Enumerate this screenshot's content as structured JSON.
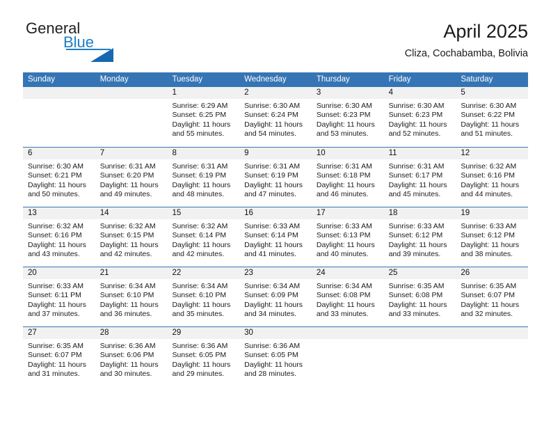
{
  "brand": {
    "word_one": "General",
    "word_two": "Blue",
    "mark": "triangle-logo"
  },
  "header": {
    "title": "April 2025",
    "subtitle": "Cliza, Cochabamba, Bolivia"
  },
  "colors": {
    "header_blue": "#3575b5",
    "brand_blue": "#1b7fc4",
    "brand_mark_blue": "#1669b0",
    "day_number_band": "#f1f1f1",
    "text": "#1a1a1a"
  },
  "weekdays": [
    "Sunday",
    "Monday",
    "Tuesday",
    "Wednesday",
    "Thursday",
    "Friday",
    "Saturday"
  ],
  "weeks": [
    [
      {
        "day": "",
        "empty": true
      },
      {
        "day": "",
        "empty": true
      },
      {
        "day": "1",
        "sunrise": "Sunrise: 6:29 AM",
        "sunset": "Sunset: 6:25 PM",
        "daylight": "Daylight: 11 hours and 55 minutes."
      },
      {
        "day": "2",
        "sunrise": "Sunrise: 6:30 AM",
        "sunset": "Sunset: 6:24 PM",
        "daylight": "Daylight: 11 hours and 54 minutes."
      },
      {
        "day": "3",
        "sunrise": "Sunrise: 6:30 AM",
        "sunset": "Sunset: 6:23 PM",
        "daylight": "Daylight: 11 hours and 53 minutes."
      },
      {
        "day": "4",
        "sunrise": "Sunrise: 6:30 AM",
        "sunset": "Sunset: 6:23 PM",
        "daylight": "Daylight: 11 hours and 52 minutes."
      },
      {
        "day": "5",
        "sunrise": "Sunrise: 6:30 AM",
        "sunset": "Sunset: 6:22 PM",
        "daylight": "Daylight: 11 hours and 51 minutes."
      }
    ],
    [
      {
        "day": "6",
        "sunrise": "Sunrise: 6:30 AM",
        "sunset": "Sunset: 6:21 PM",
        "daylight": "Daylight: 11 hours and 50 minutes."
      },
      {
        "day": "7",
        "sunrise": "Sunrise: 6:31 AM",
        "sunset": "Sunset: 6:20 PM",
        "daylight": "Daylight: 11 hours and 49 minutes."
      },
      {
        "day": "8",
        "sunrise": "Sunrise: 6:31 AM",
        "sunset": "Sunset: 6:19 PM",
        "daylight": "Daylight: 11 hours and 48 minutes."
      },
      {
        "day": "9",
        "sunrise": "Sunrise: 6:31 AM",
        "sunset": "Sunset: 6:19 PM",
        "daylight": "Daylight: 11 hours and 47 minutes."
      },
      {
        "day": "10",
        "sunrise": "Sunrise: 6:31 AM",
        "sunset": "Sunset: 6:18 PM",
        "daylight": "Daylight: 11 hours and 46 minutes."
      },
      {
        "day": "11",
        "sunrise": "Sunrise: 6:31 AM",
        "sunset": "Sunset: 6:17 PM",
        "daylight": "Daylight: 11 hours and 45 minutes."
      },
      {
        "day": "12",
        "sunrise": "Sunrise: 6:32 AM",
        "sunset": "Sunset: 6:16 PM",
        "daylight": "Daylight: 11 hours and 44 minutes."
      }
    ],
    [
      {
        "day": "13",
        "sunrise": "Sunrise: 6:32 AM",
        "sunset": "Sunset: 6:16 PM",
        "daylight": "Daylight: 11 hours and 43 minutes."
      },
      {
        "day": "14",
        "sunrise": "Sunrise: 6:32 AM",
        "sunset": "Sunset: 6:15 PM",
        "daylight": "Daylight: 11 hours and 42 minutes."
      },
      {
        "day": "15",
        "sunrise": "Sunrise: 6:32 AM",
        "sunset": "Sunset: 6:14 PM",
        "daylight": "Daylight: 11 hours and 42 minutes."
      },
      {
        "day": "16",
        "sunrise": "Sunrise: 6:33 AM",
        "sunset": "Sunset: 6:14 PM",
        "daylight": "Daylight: 11 hours and 41 minutes."
      },
      {
        "day": "17",
        "sunrise": "Sunrise: 6:33 AM",
        "sunset": "Sunset: 6:13 PM",
        "daylight": "Daylight: 11 hours and 40 minutes."
      },
      {
        "day": "18",
        "sunrise": "Sunrise: 6:33 AM",
        "sunset": "Sunset: 6:12 PM",
        "daylight": "Daylight: 11 hours and 39 minutes."
      },
      {
        "day": "19",
        "sunrise": "Sunrise: 6:33 AM",
        "sunset": "Sunset: 6:12 PM",
        "daylight": "Daylight: 11 hours and 38 minutes."
      }
    ],
    [
      {
        "day": "20",
        "sunrise": "Sunrise: 6:33 AM",
        "sunset": "Sunset: 6:11 PM",
        "daylight": "Daylight: 11 hours and 37 minutes."
      },
      {
        "day": "21",
        "sunrise": "Sunrise: 6:34 AM",
        "sunset": "Sunset: 6:10 PM",
        "daylight": "Daylight: 11 hours and 36 minutes."
      },
      {
        "day": "22",
        "sunrise": "Sunrise: 6:34 AM",
        "sunset": "Sunset: 6:10 PM",
        "daylight": "Daylight: 11 hours and 35 minutes."
      },
      {
        "day": "23",
        "sunrise": "Sunrise: 6:34 AM",
        "sunset": "Sunset: 6:09 PM",
        "daylight": "Daylight: 11 hours and 34 minutes."
      },
      {
        "day": "24",
        "sunrise": "Sunrise: 6:34 AM",
        "sunset": "Sunset: 6:08 PM",
        "daylight": "Daylight: 11 hours and 33 minutes."
      },
      {
        "day": "25",
        "sunrise": "Sunrise: 6:35 AM",
        "sunset": "Sunset: 6:08 PM",
        "daylight": "Daylight: 11 hours and 33 minutes."
      },
      {
        "day": "26",
        "sunrise": "Sunrise: 6:35 AM",
        "sunset": "Sunset: 6:07 PM",
        "daylight": "Daylight: 11 hours and 32 minutes."
      }
    ],
    [
      {
        "day": "27",
        "sunrise": "Sunrise: 6:35 AM",
        "sunset": "Sunset: 6:07 PM",
        "daylight": "Daylight: 11 hours and 31 minutes."
      },
      {
        "day": "28",
        "sunrise": "Sunrise: 6:36 AM",
        "sunset": "Sunset: 6:06 PM",
        "daylight": "Daylight: 11 hours and 30 minutes."
      },
      {
        "day": "29",
        "sunrise": "Sunrise: 6:36 AM",
        "sunset": "Sunset: 6:05 PM",
        "daylight": "Daylight: 11 hours and 29 minutes."
      },
      {
        "day": "30",
        "sunrise": "Sunrise: 6:36 AM",
        "sunset": "Sunset: 6:05 PM",
        "daylight": "Daylight: 11 hours and 28 minutes."
      },
      {
        "day": "",
        "empty": true
      },
      {
        "day": "",
        "empty": true
      },
      {
        "day": "",
        "empty": true
      }
    ]
  ]
}
